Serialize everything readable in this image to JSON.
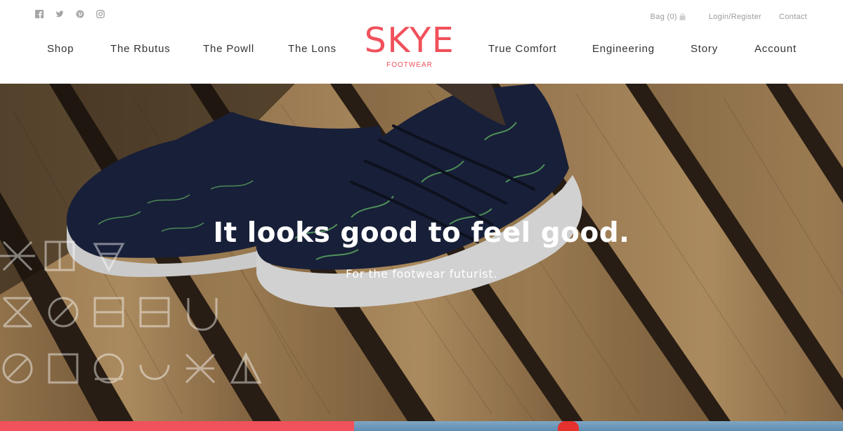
{
  "header": {
    "social": [
      {
        "name": "facebook-icon"
      },
      {
        "name": "twitter-icon"
      },
      {
        "name": "pinterest-icon"
      },
      {
        "name": "instagram-icon"
      }
    ],
    "utility": {
      "bag_label": "Bag (0)",
      "bag_icon": "bag-icon",
      "login_label": "Login/Register",
      "contact_label": "Contact"
    },
    "nav_left": [
      "Shop",
      "The Rbutus",
      "The Powll",
      "The Lons"
    ],
    "nav_right": [
      "True Comfort",
      "Engineering",
      "Story",
      "Account"
    ],
    "logo": {
      "word": "SKYE",
      "sub": "FOOTWEAR"
    }
  },
  "hero": {
    "title": "It looks good to feel good.",
    "subtitle": "For the footwear futurist."
  },
  "colors": {
    "brand": "#f0515b",
    "nav_text": "#333333",
    "utility_text": "#9a9a9a",
    "shoe_navy": "#1c2440",
    "shoe_pattern": "#6fcf74",
    "wood": "#8a6a44"
  }
}
